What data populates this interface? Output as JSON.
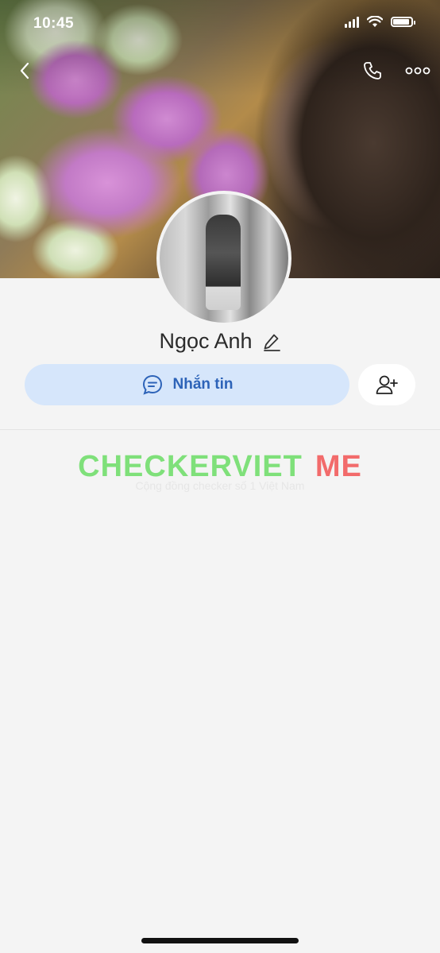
{
  "status_bar": {
    "time": "10:45"
  },
  "profile": {
    "name": "Ngọc Anh"
  },
  "actions": {
    "message_label": "Nhắn tin"
  },
  "watermark": {
    "title_part1": "CHECKERVIET",
    "title_part2": "ME",
    "subtitle": "Cộng đồng checker số 1 Việt Nam"
  },
  "icons": {
    "back": "chevron-left-icon",
    "call": "phone-icon",
    "more": "more-dots-icon",
    "edit": "pencil-icon",
    "chat": "chat-bubble-icon",
    "add_friend": "add-friend-icon"
  },
  "colors": {
    "accent": "#2d63b8",
    "button_bg": "#d6e6fb",
    "background": "#f4f4f4"
  }
}
